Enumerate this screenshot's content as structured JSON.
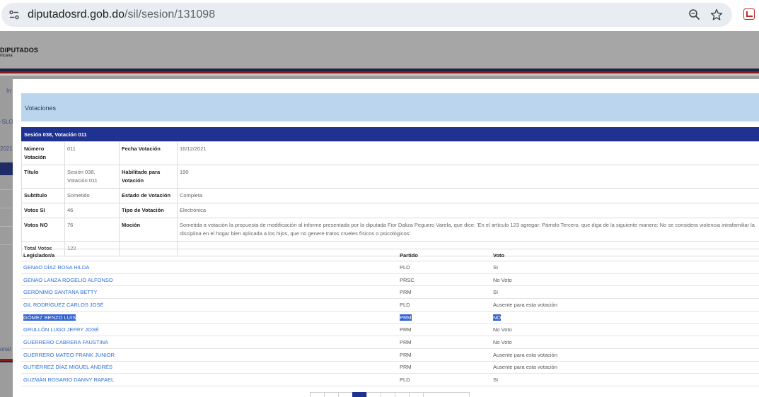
{
  "browser": {
    "url_domain": "diputadosrd.gob.do",
    "url_path": "/sil/sesion/131098"
  },
  "background_site": {
    "logo_title": "DIPUTADOS",
    "logo_subtitle": "nicana",
    "fragments": [
      "In",
      "-SLO",
      "2021 -",
      "orial"
    ]
  },
  "modal": {
    "title": "Votaciones",
    "vote_header": "Sesión 038, Votación 011",
    "details": {
      "numero_label": "Número Votación",
      "numero_value": "011",
      "fecha_label": "Fecha Votación",
      "fecha_value": "16/12/2021",
      "titulo_label": "Título",
      "titulo_value": "Sesión 038, Votación 011",
      "habilitado_label": "Habilitado para Votación",
      "habilitado_value": "190",
      "subtitulo_label": "Subtítulo",
      "subtitulo_value": "Sometido",
      "estado_label": "Estado de Votación",
      "estado_value": "Completa",
      "votos_si_label": "Votos SI",
      "votos_si_value": "46",
      "tipo_label": "Tipo de Votación",
      "tipo_value": "Electrónica",
      "votos_no_label": "Votos NO",
      "votos_no_value": "76",
      "mocion_label": "Moción",
      "mocion_value": "Sometida a votación la propuesta de modificación al informe presentada por la diputada Fior Daliza Peguero Varela, que dice: 'En el artículo 123 agregar: Párrafo Tercero, que diga de la siguiente manera: No se considera violencia intrafamiliar la disciplina en el hogar bien aplicada a los hijos, que no genere tratos crueles físicos o psicológicos'.",
      "total_label": "Total Votos",
      "total_value": "122"
    },
    "results": {
      "headers": {
        "legislador": "Legislador/a",
        "partido": "Partido",
        "voto": "Voto"
      },
      "rows": [
        {
          "legislador": "GENAO DÍAZ ROSA HILDA",
          "partido": "PLD",
          "voto": "SI"
        },
        {
          "legislador": "GENAO LANZA ROGELIO ALFONSO",
          "partido": "PRSC",
          "voto": "No Voto"
        },
        {
          "legislador": "GERÓNIMO SANTANA BETTY",
          "partido": "PRM",
          "voto": "SI"
        },
        {
          "legislador": "GIL RODRÍGUEZ CARLOS JOSÉ",
          "partido": "PLD",
          "voto": "Ausente para esta votación"
        },
        {
          "legislador": "GÓMEZ BENZO LUIS",
          "partido": "PRM",
          "voto": "NO"
        },
        {
          "legislador": "GRULLÓN LUGO JEFRY JOSÉ",
          "partido": "PRM",
          "voto": "No Voto"
        },
        {
          "legislador": "GUERRERO CABRERA FAUSTINA",
          "partido": "PRM",
          "voto": "No Voto"
        },
        {
          "legislador": "GUERRERO MATEO FRANK JUNIOR",
          "partido": "PRM",
          "voto": "Ausente para esta votación"
        },
        {
          "legislador": "GUTIÉRREZ DÍAZ MIGUEL ANDRÉS",
          "partido": "PRM",
          "voto": "Ausente para esta votación"
        },
        {
          "legislador": "GUZMÁN ROSARIO DANNY RAFAEL",
          "partido": "PLD",
          "voto": "SI"
        }
      ],
      "selected_row": 4
    }
  },
  "colors": {
    "vote_bar": "#1f3290",
    "modal_header": "#bcd5ef",
    "link": "#2f6fd6",
    "selection": "#2f5fd0"
  },
  "icons": [
    "site-info-icon",
    "zoom-icon",
    "bookmark-star-icon",
    "extension-icon"
  ]
}
